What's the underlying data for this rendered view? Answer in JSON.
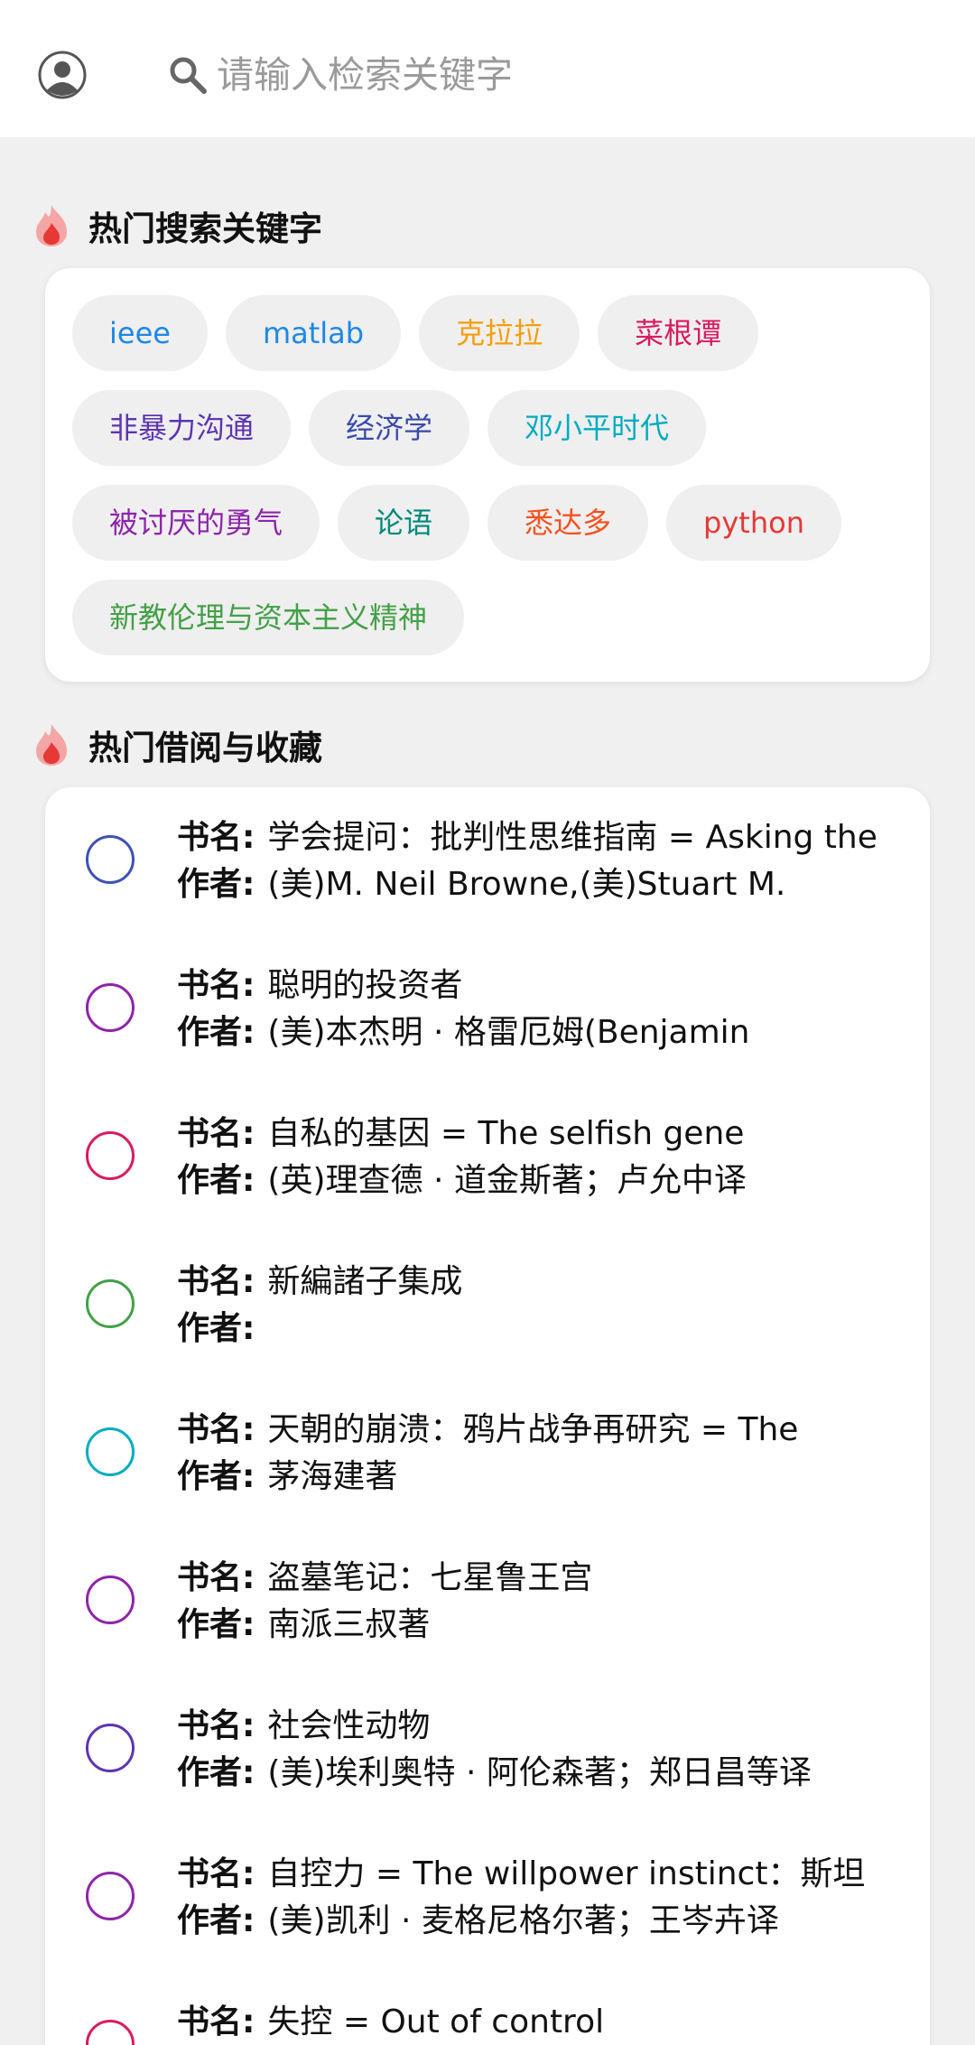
{
  "search": {
    "placeholder": "请输入检索关键字"
  },
  "hot_keywords": {
    "title": "热门搜索关键字",
    "tags": [
      {
        "label": "ieee",
        "color": "#1e88e5"
      },
      {
        "label": "matlab",
        "color": "#1e88e5"
      },
      {
        "label": "克拉拉",
        "color": "#f59e0b"
      },
      {
        "label": "菜根谭",
        "color": "#d81b60"
      },
      {
        "label": "非暴力沟通",
        "color": "#5e35b1"
      },
      {
        "label": "经济学",
        "color": "#3949ab"
      },
      {
        "label": "邓小平时代",
        "color": "#00acc1"
      },
      {
        "label": "被讨厌的勇气",
        "color": "#8e24aa"
      },
      {
        "label": "论语",
        "color": "#00897b"
      },
      {
        "label": "悉达多",
        "color": "#f4511e"
      },
      {
        "label": "python",
        "color": "#e53935"
      },
      {
        "label": "新教伦理与资本主义精神",
        "color": "#43a047"
      }
    ]
  },
  "hot_books": {
    "title": "热门借阅与收藏",
    "name_label": "书名:",
    "author_label": "作者:",
    "items": [
      {
        "title": "学会提问：批判性思维指南 = Asking the",
        "author": "(美)M. Neil Browne,(美)Stuart M.",
        "color": "#3f51b5"
      },
      {
        "title": "聪明的投资者",
        "author": "(美)本杰明 · 格雷厄姆(Benjamin",
        "color": "#8e24aa"
      },
      {
        "title": "自私的基因 = The selfish gene",
        "author": "(英)理查德 · 道金斯著；卢允中译",
        "color": "#d81b60"
      },
      {
        "title": "新編諸子集成",
        "author": "",
        "color": "#43a047"
      },
      {
        "title": "天朝的崩溃：鸦片战争再研究 = The",
        "author": "茅海建著",
        "color": "#00acc1"
      },
      {
        "title": "盗墓笔记：七星鲁王宫",
        "author": "南派三叔著",
        "color": "#8e24aa"
      },
      {
        "title": "社会性动物",
        "author": "(美)埃利奥特 · 阿伦森著；郑日昌等译",
        "color": "#5e35b1"
      },
      {
        "title": "自控力 = The willpower instinct：斯坦",
        "author": "(美)凯利 · 麦格尼格尔著；王岑卉译",
        "color": "#8e24aa"
      },
      {
        "title": "失控 = Out of control",
        "author": "",
        "color": "#d81b60"
      }
    ]
  }
}
